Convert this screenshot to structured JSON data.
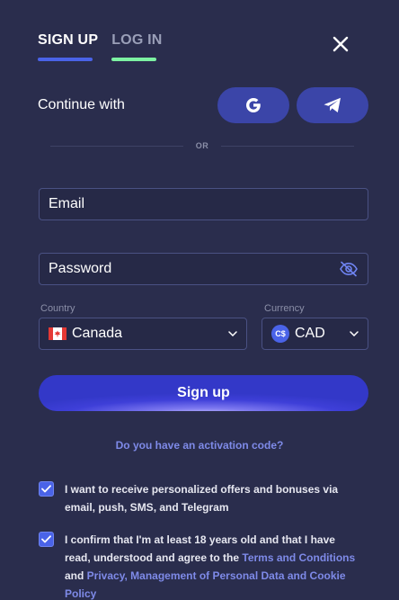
{
  "tabs": {
    "signup": "SIGN UP",
    "login": "LOG IN"
  },
  "social": {
    "label": "Continue with",
    "google_icon": "google-icon",
    "telegram_icon": "telegram-icon"
  },
  "divider": {
    "text": "OR"
  },
  "form": {
    "email_placeholder": "Email",
    "password_placeholder": "Password",
    "country_label": "Country",
    "country_value": "Canada",
    "currency_label": "Currency",
    "currency_value": "CAD",
    "currency_symbol": "C$"
  },
  "signup_button": "Sign up",
  "activation_link": "Do you have an activation code?",
  "consents": {
    "offers_text": "I want to receive personalized offers and bonuses via email, push, SMS, and Telegram",
    "age_text_1": "I confirm that I'm at least 18 years old and that I have read, understood and agree to the ",
    "terms_link": "Terms and Conditions",
    "and_text": " and ",
    "privacy_link": "Privacy, Management of Personal Data and Cookie Policy"
  },
  "colors": {
    "background": "#2a2d4d",
    "accent": "#4a63e8",
    "login_underline": "#7df2a2",
    "link": "#7e8ae8"
  }
}
